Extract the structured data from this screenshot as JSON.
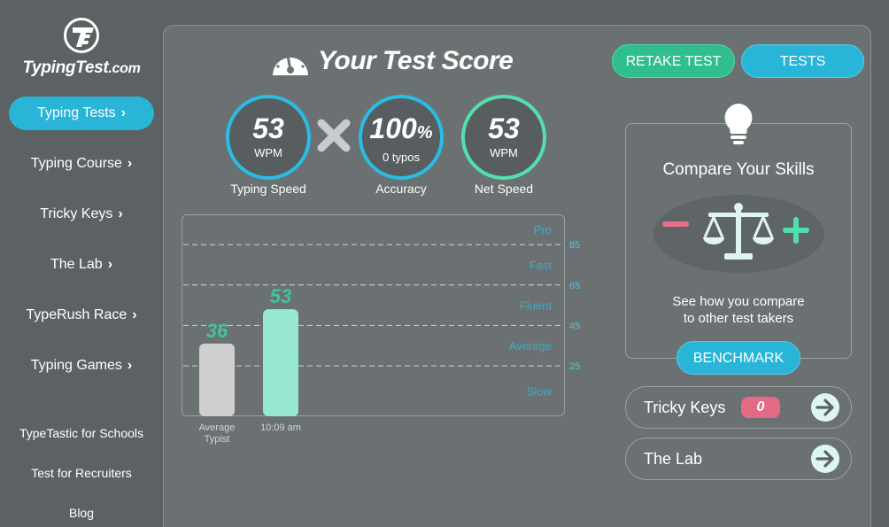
{
  "brand": {
    "name": "TypingTest",
    "suffix": ".com"
  },
  "sidebar": {
    "items": [
      {
        "label": "Typing Tests",
        "active": true
      },
      {
        "label": "Typing Course"
      },
      {
        "label": "Tricky Keys"
      },
      {
        "label": "The Lab"
      },
      {
        "label": "TypeRush Race"
      },
      {
        "label": "Typing Games"
      }
    ],
    "chevron": "›",
    "sub_items": [
      "TypeTastic for Schools",
      "Test for Recruiters",
      "Blog"
    ]
  },
  "main": {
    "title": "Your Test Score",
    "retake_label": "RETAKE TEST",
    "tests_label": "TESTS",
    "stats": [
      {
        "value": "53",
        "unit": "WPM",
        "caption": "Typing Speed"
      },
      {
        "value": "100",
        "value_suffix": "%",
        "unit": "0  typos",
        "caption": "Accuracy"
      },
      {
        "value": "53",
        "unit": "WPM",
        "caption": "Net Speed"
      }
    ]
  },
  "chart_data": {
    "type": "bar",
    "categories": [
      "Average Typist",
      "10:09 am"
    ],
    "values": [
      36,
      53
    ],
    "data_labels": [
      "36",
      "53"
    ],
    "colors": [
      "#cfcfcf",
      "#97e8d3"
    ],
    "ylim": [
      0,
      100
    ],
    "gridlines": [
      25,
      45,
      65,
      85
    ],
    "levels": [
      "Pro",
      "Fast",
      "Fluent",
      "Average",
      "Slow"
    ],
    "grid": true
  },
  "compare": {
    "title": "Compare Your Skills",
    "text_line1": "See how you compare",
    "text_line2": "to other test takers",
    "benchmark_label": "BENCHMARK"
  },
  "links": {
    "tricky_keys": {
      "label": "Tricky Keys",
      "badge": "0"
    },
    "the_lab": {
      "label": "The Lab"
    }
  },
  "colors": {
    "accent_blue": "#29b5d8",
    "accent_green": "#2fbe8e",
    "badge_pink": "#e46a86",
    "background": "#5c6263"
  }
}
